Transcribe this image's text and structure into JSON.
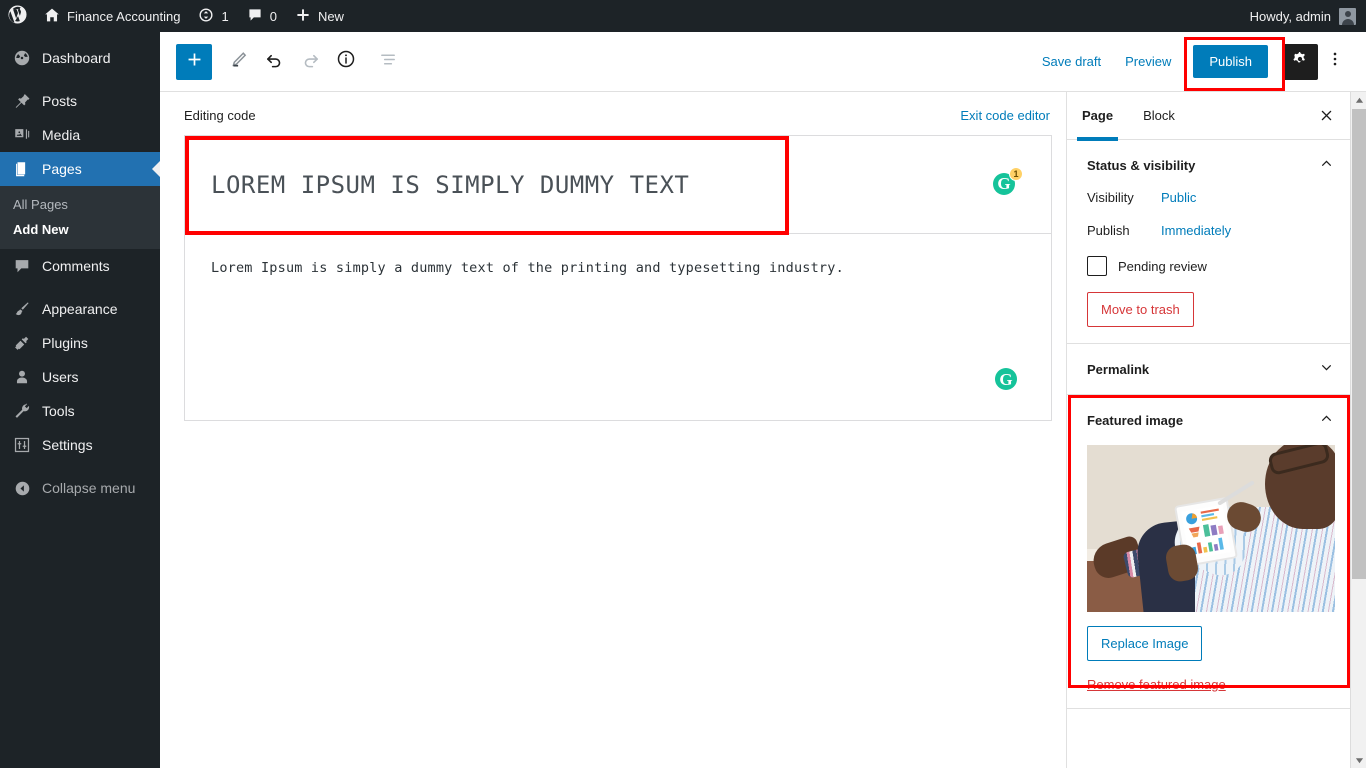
{
  "adminbar": {
    "logo_icon": "wordpress-logo-icon",
    "site_icon": "home-icon",
    "site_name": "Finance Accounting",
    "updates_icon": "updates-icon",
    "updates_count": "1",
    "comments_icon": "comment-bubble-icon",
    "comments_count": "0",
    "new_icon": "plus-icon",
    "new_label": "New",
    "howdy": "Howdy, admin",
    "avatar_icon": "user-avatar-icon"
  },
  "sidebar": {
    "items": [
      {
        "label": "Dashboard",
        "icon": "dashboard-icon",
        "current": false
      },
      {
        "label": "Posts",
        "icon": "pin-icon",
        "current": false
      },
      {
        "label": "Media",
        "icon": "media-icon",
        "current": false
      },
      {
        "label": "Pages",
        "icon": "pages-icon",
        "current": true
      },
      {
        "label": "Comments",
        "icon": "comment-icon",
        "current": false
      },
      {
        "label": "Appearance",
        "icon": "brush-icon",
        "current": false
      },
      {
        "label": "Plugins",
        "icon": "plug-icon",
        "current": false
      },
      {
        "label": "Users",
        "icon": "user-icon",
        "current": false
      },
      {
        "label": "Tools",
        "icon": "wrench-icon",
        "current": false
      },
      {
        "label": "Settings",
        "icon": "settings-sliders-icon",
        "current": false
      }
    ],
    "submenu": [
      {
        "label": "All Pages",
        "current": false
      },
      {
        "label": "Add New",
        "current": true
      }
    ],
    "collapse_label": "Collapse menu",
    "collapse_icon": "collapse-arrow-icon",
    "highlight_color": "#ff0000",
    "active_color": "#2271b1"
  },
  "toolbar": {
    "add_block_icon": "plus-icon",
    "edit_icon": "pencil-icon",
    "undo_icon": "undo-arrow-icon",
    "redo_icon": "redo-arrow-icon",
    "info_icon": "info-circle-icon",
    "list_view_icon": "list-view-icon",
    "save_draft_label": "Save draft",
    "preview_label": "Preview",
    "publish_label": "Publish",
    "settings_icon": "gear-icon",
    "more_icon": "vertical-ellipsis-icon",
    "publish_color": "#007cba"
  },
  "editor": {
    "mode_label": "Editing code",
    "exit_label": "Exit code editor",
    "title_value": "LOREM IPSUM IS SIMPLY DUMMY TEXT",
    "body_value": "Lorem Ipsum is simply a dummy text of the printing and typesetting industry.",
    "grammarly_icon": "grammarly-icon",
    "grammarly_letter": "G",
    "grammarly_badge_count": "1",
    "grammarly_color": "#15c39a"
  },
  "inspector": {
    "tabs": [
      {
        "label": "Page",
        "active": true
      },
      {
        "label": "Block",
        "active": false
      }
    ],
    "close_icon": "close-icon",
    "status_panel": {
      "title": "Status & visibility",
      "chevron_icon": "chevron-up-icon",
      "visibility_label": "Visibility",
      "visibility_value": "Public",
      "publish_label": "Publish",
      "publish_value": "Immediately",
      "pending_label": "Pending review",
      "pending_checked": false,
      "trash_label": "Move to trash",
      "trash_color": "#d63638"
    },
    "permalink_panel": {
      "title": "Permalink",
      "chevron_icon": "chevron-down-icon"
    },
    "featured_panel": {
      "title": "Featured image",
      "chevron_icon": "chevron-up-icon",
      "image_alt": "man reclining with feet up viewing charts on a tablet",
      "replace_label": "Replace Image",
      "remove_label": "Remove featured image",
      "highlight_color": "#ff0000"
    }
  },
  "scrollbar": {
    "up_icon": "scroll-up-arrow-icon",
    "down_icon": "scroll-down-arrow-icon"
  }
}
